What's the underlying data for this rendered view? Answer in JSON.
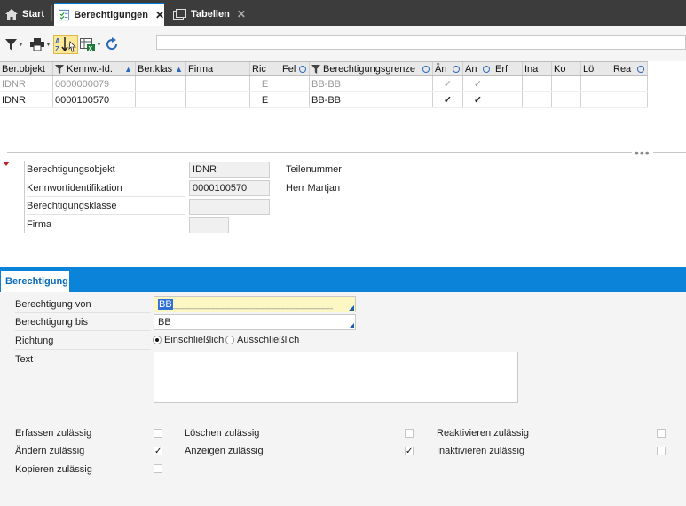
{
  "tabs": [
    {
      "label": "Start",
      "icon": "home-icon"
    },
    {
      "label": "Berechtigungen",
      "icon": "checklist-icon",
      "active": true
    },
    {
      "label": "Tabellen",
      "icon": "tables-icon"
    }
  ],
  "toolbar": {
    "buttons": [
      "filter-icon",
      "print-icon",
      "sort-az-icon",
      "export-excel-icon",
      "refresh-icon"
    ],
    "search_value": ""
  },
  "grid": {
    "columns": [
      "Ber.objekt",
      "Kennw.-Id.",
      "Ber.klas",
      "Firma",
      "Ric",
      "Fel",
      "Berechtigungsgrenze",
      "Än",
      "An",
      "Erf",
      "Ina",
      "Ko",
      "Lö",
      "Rea"
    ],
    "rows": [
      [
        "IDNR",
        "0000000079",
        "",
        "",
        "E",
        "",
        "BB-BB",
        "✓",
        "✓",
        "",
        "",
        "",
        "",
        ""
      ],
      [
        "IDNR",
        "0000100570",
        "",
        "",
        "E",
        "",
        "BB-BB",
        "✓",
        "✓",
        "",
        "",
        "",
        "",
        ""
      ]
    ]
  },
  "detail": {
    "fields": [
      {
        "label": "Berechtigungsobjekt",
        "value": "IDNR",
        "desc": "Teilenummer"
      },
      {
        "label": "Kennwortidentifikation",
        "value": "0000100570",
        "desc": "Herr Martjan"
      },
      {
        "label": "Berechtigungsklasse",
        "value": "",
        "desc": ""
      },
      {
        "label": "Firma",
        "value": "",
        "desc": ""
      }
    ]
  },
  "section": {
    "tab_label": "Berechtigung",
    "von_label": "Berechtigung von",
    "von_value": "BB",
    "von_mask": "________________________________",
    "bis_label": "Berechtigung bis",
    "bis_value": "BB",
    "richtung_label": "Richtung",
    "radio_incl": "Einschließlich",
    "radio_excl": "Ausschließlich",
    "text_label": "Text"
  },
  "checks": [
    {
      "label": "Erfassen zulässig",
      "checked": false
    },
    {
      "label": "Ändern zulässig",
      "checked": true
    },
    {
      "label": "Kopieren zulässig",
      "checked": false
    },
    {
      "label": "Löschen zulässig",
      "checked": false
    },
    {
      "label": "Anzeigen zulässig",
      "checked": true
    },
    {
      "label": "Reaktivieren zulässig",
      "checked": false
    },
    {
      "label": "Inaktivieren zulässig",
      "checked": false
    }
  ],
  "colors": {
    "accent": "#0a83d8",
    "tabbar": "#3c3c3c"
  }
}
